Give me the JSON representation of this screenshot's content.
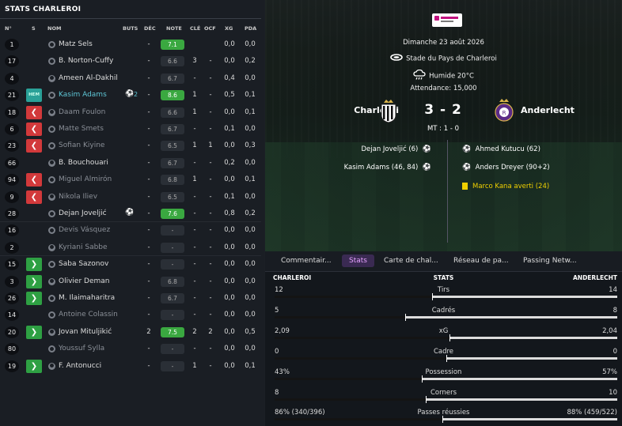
{
  "left": {
    "title": "STATS CHARLEROI",
    "headers": [
      "N°",
      "S",
      "NOM",
      "BUTS",
      "DÉC",
      "NOTE",
      "CLÉ",
      "OCF",
      "XG",
      "PDA"
    ],
    "players": [
      {
        "num": "1",
        "status": "",
        "name": "Matz Sels",
        "goals": "",
        "dec": "-",
        "note": "7.1",
        "note_green": true,
        "cle": "",
        "ocf": "",
        "xg": "0,0",
        "pda": "0,0",
        "dim": false,
        "hl": false,
        "ball": false
      },
      {
        "num": "17",
        "status": "",
        "name": "B. Norton-Cuffy",
        "goals": "",
        "dec": "-",
        "note": "6.6",
        "note_green": false,
        "cle": "3",
        "ocf": "-",
        "xg": "0,0",
        "pda": "0,2",
        "dim": false,
        "hl": false,
        "ball": false
      },
      {
        "num": "4",
        "status": "",
        "name": "Ameen Al-Dakhil",
        "goals": "",
        "dec": "-",
        "note": "6.7",
        "note_green": false,
        "cle": "-",
        "ocf": "-",
        "xg": "0,4",
        "pda": "0,0",
        "dim": false,
        "hl": false,
        "ball": false
      },
      {
        "num": "21",
        "status": "hm",
        "status_label": "HEM",
        "name": "Kasim Adams",
        "goals": "2",
        "dec": "-",
        "note": "8.6",
        "note_green": true,
        "cle": "1",
        "ocf": "-",
        "xg": "0,5",
        "pda": "0,1",
        "dim": false,
        "hl": true,
        "ball": true
      },
      {
        "num": "18",
        "status": "out",
        "name": "Daam Foulon",
        "goals": "",
        "dec": "-",
        "note": "6.6",
        "note_green": false,
        "cle": "1",
        "ocf": "-",
        "xg": "0,0",
        "pda": "0,1",
        "dim": true,
        "hl": false,
        "ball": false
      },
      {
        "num": "6",
        "status": "out",
        "name": "Matte Smets",
        "goals": "",
        "dec": "-",
        "note": "6.7",
        "note_green": false,
        "cle": "-",
        "ocf": "-",
        "xg": "0,1",
        "pda": "0,0",
        "dim": true,
        "hl": false,
        "ball": false
      },
      {
        "num": "23",
        "status": "out",
        "name": "Sofian Kiyine",
        "goals": "",
        "dec": "-",
        "note": "6.5",
        "note_green": false,
        "cle": "1",
        "ocf": "1",
        "xg": "0,0",
        "pda": "0,3",
        "dim": true,
        "hl": false,
        "ball": false
      },
      {
        "num": "66",
        "status": "",
        "name": "B. Bouchouari",
        "goals": "",
        "dec": "-",
        "note": "6.7",
        "note_green": false,
        "cle": "-",
        "ocf": "-",
        "xg": "0,2",
        "pda": "0,0",
        "dim": false,
        "hl": false,
        "ball": false
      },
      {
        "num": "94",
        "status": "out",
        "name": "Miguel Almirón",
        "goals": "",
        "dec": "-",
        "note": "6.8",
        "note_green": false,
        "cle": "1",
        "ocf": "-",
        "xg": "0,0",
        "pda": "0,1",
        "dim": true,
        "hl": false,
        "ball": false
      },
      {
        "num": "9",
        "status": "out",
        "name": "Nikola Iliev",
        "goals": "",
        "dec": "-",
        "note": "6.5",
        "note_green": false,
        "cle": "-",
        "ocf": "-",
        "xg": "0,1",
        "pda": "0,0",
        "dim": true,
        "hl": false,
        "ball": false
      },
      {
        "num": "28",
        "status": "",
        "name": "Dejan Joveljić",
        "goals": "",
        "dec": "-",
        "note": "7.6",
        "note_green": true,
        "cle": "-",
        "ocf": "-",
        "xg": "0,8",
        "pda": "0,2",
        "dim": false,
        "hl": false,
        "ball": true
      },
      {
        "num": "16",
        "status": "",
        "name": "Devis Vásquez",
        "goals": "",
        "dec": "-",
        "note": "-",
        "note_green": false,
        "cle": "-",
        "ocf": "-",
        "xg": "0,0",
        "pda": "0,0",
        "dim": true,
        "hl": false,
        "ball": false
      },
      {
        "num": "2",
        "status": "",
        "name": "Kyriani Sabbe",
        "goals": "",
        "dec": "-",
        "note": "-",
        "note_green": false,
        "cle": "-",
        "ocf": "-",
        "xg": "0,0",
        "pda": "0,0",
        "dim": true,
        "hl": false,
        "ball": false
      },
      {
        "num": "15",
        "status": "in",
        "name": "Saba Sazonov",
        "goals": "",
        "dec": "-",
        "note": "-",
        "note_green": false,
        "cle": "-",
        "ocf": "-",
        "xg": "0,0",
        "pda": "0,0",
        "dim": false,
        "hl": false,
        "ball": false
      },
      {
        "num": "3",
        "status": "in",
        "name": "Olivier Deman",
        "goals": "",
        "dec": "-",
        "note": "6.8",
        "note_green": false,
        "cle": "-",
        "ocf": "-",
        "xg": "0,0",
        "pda": "0,0",
        "dim": false,
        "hl": false,
        "ball": false
      },
      {
        "num": "26",
        "status": "in",
        "name": "M. Ilaimaharitra",
        "goals": "",
        "dec": "-",
        "note": "6.7",
        "note_green": false,
        "cle": "-",
        "ocf": "-",
        "xg": "0,0",
        "pda": "0,0",
        "dim": false,
        "hl": false,
        "ball": false
      },
      {
        "num": "14",
        "status": "",
        "name": "Antoine Colassin",
        "goals": "",
        "dec": "-",
        "note": "-",
        "note_green": false,
        "cle": "-",
        "ocf": "-",
        "xg": "0,0",
        "pda": "0,0",
        "dim": true,
        "hl": false,
        "ball": false
      },
      {
        "num": "20",
        "status": "in",
        "name": "Jovan Mituljikić",
        "goals": "",
        "dec": "2",
        "note": "7.5",
        "note_green": true,
        "cle": "2",
        "ocf": "2",
        "xg": "0,0",
        "pda": "0,5",
        "dim": false,
        "hl": false,
        "ball": false
      },
      {
        "num": "80",
        "status": "",
        "name": "Youssuf Sylla",
        "goals": "",
        "dec": "-",
        "note": "-",
        "note_green": false,
        "cle": "-",
        "ocf": "-",
        "xg": "0,0",
        "pda": "0,0",
        "dim": true,
        "hl": false,
        "ball": false
      },
      {
        "num": "19",
        "status": "in",
        "name": "F. Antonucci",
        "goals": "",
        "dec": "-",
        "note": "-",
        "note_green": false,
        "cle": "1",
        "ocf": "-",
        "xg": "0,0",
        "pda": "0,1",
        "dim": false,
        "hl": false,
        "ball": false
      }
    ]
  },
  "match": {
    "date": "Dimanche 23 août 2026",
    "stadium": "Stade du Pays de Charleroi",
    "weather": "Humide 20°C",
    "attendance": "Attendance: 15,000",
    "home": "Charleroi",
    "away": "Anderlecht",
    "score": "3 - 2",
    "halftime": "MT : 1 - 0",
    "home_events": [
      "Dejan Joveljić (6)",
      "Kasim Adams (46, 84)"
    ],
    "away_events": [
      "Ahmed Kutucu (62)",
      "Anders Dreyer (90+2)"
    ],
    "away_card": "Marco Kana averti (24)",
    "colors": {
      "card": "#f0d000",
      "tab_active": "#e6a0ff",
      "note_green": "#3aa840",
      "out": "#d2393b",
      "in": "#2ea043"
    }
  },
  "tabs": [
    "Commentair...",
    "Stats",
    "Carte de chal...",
    "Réseau de pa...",
    "Passing Netw..."
  ],
  "active_tab": 1,
  "stats": {
    "home_label": "CHARLEROI",
    "center_label": "STATS",
    "away_label": "ANDERLECHT",
    "rows": [
      {
        "label": "Tirs",
        "home": "12",
        "away": "14",
        "home_share": 0.46
      },
      {
        "label": "Cadrés",
        "home": "5",
        "away": "8",
        "home_share": 0.38
      },
      {
        "label": "xG",
        "home": "2,09",
        "away": "2,04",
        "home_share": 0.51
      },
      {
        "label": "Cadre",
        "home": "0",
        "away": "0",
        "home_share": 0.5
      },
      {
        "label": "Possession",
        "home": "43%",
        "away": "57%",
        "home_share": 0.43
      },
      {
        "label": "Corners",
        "home": "8",
        "away": "10",
        "home_share": 0.44
      },
      {
        "label": "Passes réussies",
        "home": "86% (340/396)",
        "away": "88% (459/522)",
        "home_share": 0.49
      }
    ]
  }
}
